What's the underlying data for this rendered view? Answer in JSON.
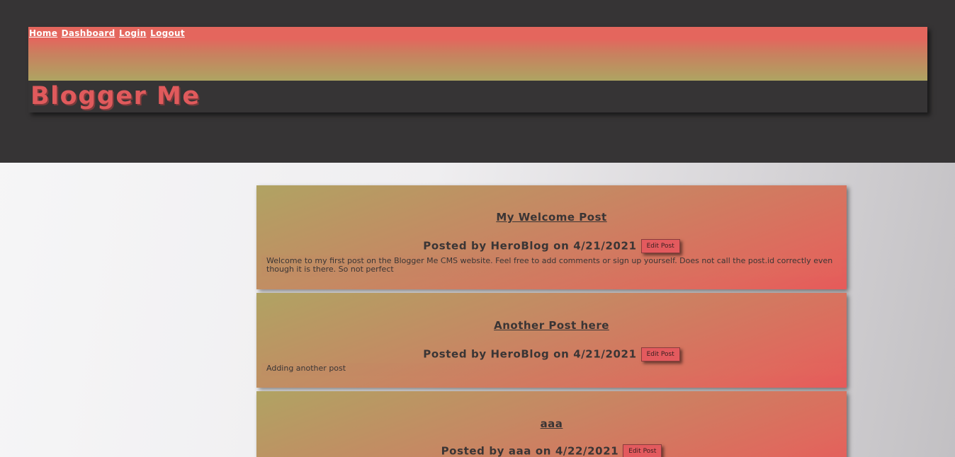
{
  "nav": {
    "links": [
      "Home",
      "Dashboard",
      "Login",
      "Logout"
    ]
  },
  "site": {
    "title": "Blogger Me"
  },
  "posts": [
    {
      "title": "My Welcome Post",
      "meta": "Posted by HeroBlog on 4/21/2021",
      "edit_label": "Edit Post",
      "body": "Welcome to my first post on the Blogger Me CMS website. Feel free to add comments or sign up yourself. Does not call the post.id correctly even though it is there. So not perfect"
    },
    {
      "title": "Another Post here",
      "meta": "Posted by HeroBlog on 4/21/2021",
      "edit_label": "Edit Post",
      "body": "Adding another post"
    },
    {
      "title": "aaa",
      "meta": "Posted by aaa on 4/22/2021",
      "edit_label": "Edit Post"
    }
  ],
  "colors": {
    "dark_bg": "#363435",
    "accent_red": "#e05a5c",
    "gradient_top": "#e4665d",
    "gradient_olive": "#aea462",
    "text_dark": "#3a3535"
  }
}
